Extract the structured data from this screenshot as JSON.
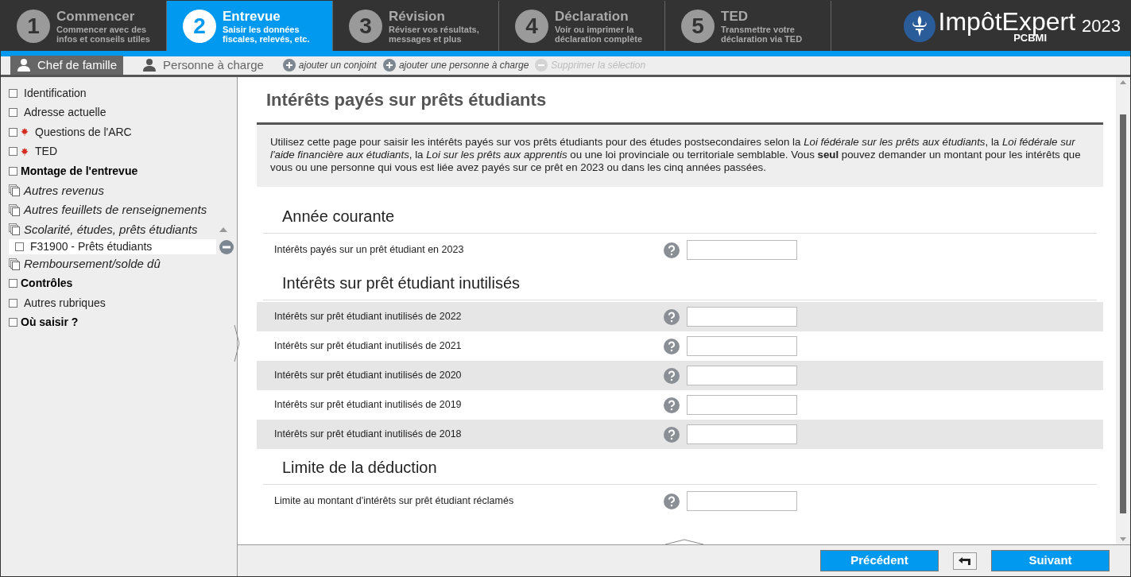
{
  "steps": [
    {
      "number": "1",
      "title": "Commencer",
      "subtitle": "Commencer avec des infos et conseils utiles",
      "selected": false
    },
    {
      "number": "2",
      "title": "Entrevue",
      "subtitle": "Saisir les données fiscales, relevés, etc.",
      "selected": true
    },
    {
      "number": "3",
      "title": "Révision",
      "subtitle": "Réviser vos résultats, messages et plus",
      "selected": false
    },
    {
      "number": "4",
      "title": "Déclaration",
      "subtitle": "Voir ou imprimer la déclaration complète",
      "selected": false
    },
    {
      "number": "5",
      "title": "TED",
      "subtitle": "Transmettre votre déclaration via TED",
      "selected": false
    }
  ],
  "logo": {
    "name": "ImpôtExpert",
    "edition": "PCBMI",
    "year": "2023"
  },
  "person_tabs": [
    {
      "label": "Chef de famille",
      "selected": true
    },
    {
      "label": "Personne à charge",
      "selected": false
    }
  ],
  "actions": [
    {
      "label": "ajouter un conjoint",
      "kind": "add",
      "disabled": false
    },
    {
      "label": "ajouter une personne à charge",
      "kind": "add",
      "disabled": false
    },
    {
      "label": "Supprimer la sélection",
      "kind": "remove",
      "disabled": true
    }
  ],
  "sidebar": {
    "items": [
      {
        "label": "Identification",
        "kind": "page",
        "flag": false,
        "checked": false
      },
      {
        "label": "Adresse actuelle",
        "kind": "page",
        "flag": false,
        "checked": false
      },
      {
        "label": "Questions de l'ARC",
        "kind": "page",
        "flag": true,
        "checked": false
      },
      {
        "label": "TED",
        "kind": "page",
        "flag": true,
        "checked": false
      },
      {
        "label": "Montage de l'entrevue",
        "kind": "section",
        "flag": false,
        "checked": false
      },
      {
        "label": "Autres revenus",
        "kind": "group",
        "expanded": false
      },
      {
        "label": "Autres feuillets de renseignements",
        "kind": "group",
        "expanded": false
      },
      {
        "label": "Scolarité, études, prêts étudiants",
        "kind": "group",
        "expanded": true,
        "children": [
          {
            "label": "F31900 - Prêts étudiants",
            "selected": true,
            "checked": false
          }
        ]
      },
      {
        "label": "Remboursement/solde dû",
        "kind": "group",
        "expanded": false
      },
      {
        "label": "Contrôles",
        "kind": "section",
        "flag": false,
        "checked": false
      },
      {
        "label": "Autres rubriques",
        "kind": "page",
        "flag": false,
        "checked": false
      },
      {
        "label": "Où saisir ?",
        "kind": "section",
        "flag": false,
        "checked": false
      }
    ]
  },
  "page": {
    "title": "Intérêts payés sur prêts étudiants",
    "intro": "Utilisez cette page pour saisir les intérêts payés sur vos prêts étudiants pour des études postsecondaires selon la *Loi fédérale sur les prêts aux étudiants*, la *Loi fédérale sur l'aide financière aux étudiants*, la *Loi sur les prêts aux apprentis* ou une loi provinciale ou territoriale semblable. Vous **seul** pouvez demander un montant pour les intérêts que vous ou une personne qui vous est liée avez payés sur ce prêt en 2023 ou dans les cinq années passées.",
    "sections": [
      {
        "title": "Année courante",
        "rows": [
          {
            "label": "Intérêts payés sur un prêt étudiant en 2023",
            "shaded": false
          }
        ]
      },
      {
        "title": "Intérêts sur prêt étudiant inutilisés",
        "rows": [
          {
            "label": "Intérêts sur prêt étudiant inutilisés de 2022",
            "shaded": true
          },
          {
            "label": "Intérêts sur prêt étudiant inutilisés de 2021",
            "shaded": false
          },
          {
            "label": "Intérêts sur prêt étudiant inutilisés de 2020",
            "shaded": true
          },
          {
            "label": "Intérêts sur prêt étudiant inutilisés de 2019",
            "shaded": false
          },
          {
            "label": "Intérêts sur prêt étudiant inutilisés de 2018",
            "shaded": true
          }
        ]
      },
      {
        "title": "Limite de la déduction",
        "rows": [
          {
            "label": "Limite au montant d'intérêts sur prêt étudiant réclamés",
            "shaded": false
          }
        ]
      }
    ]
  },
  "footer": {
    "previous": "Précédent",
    "next": "Suivant"
  }
}
